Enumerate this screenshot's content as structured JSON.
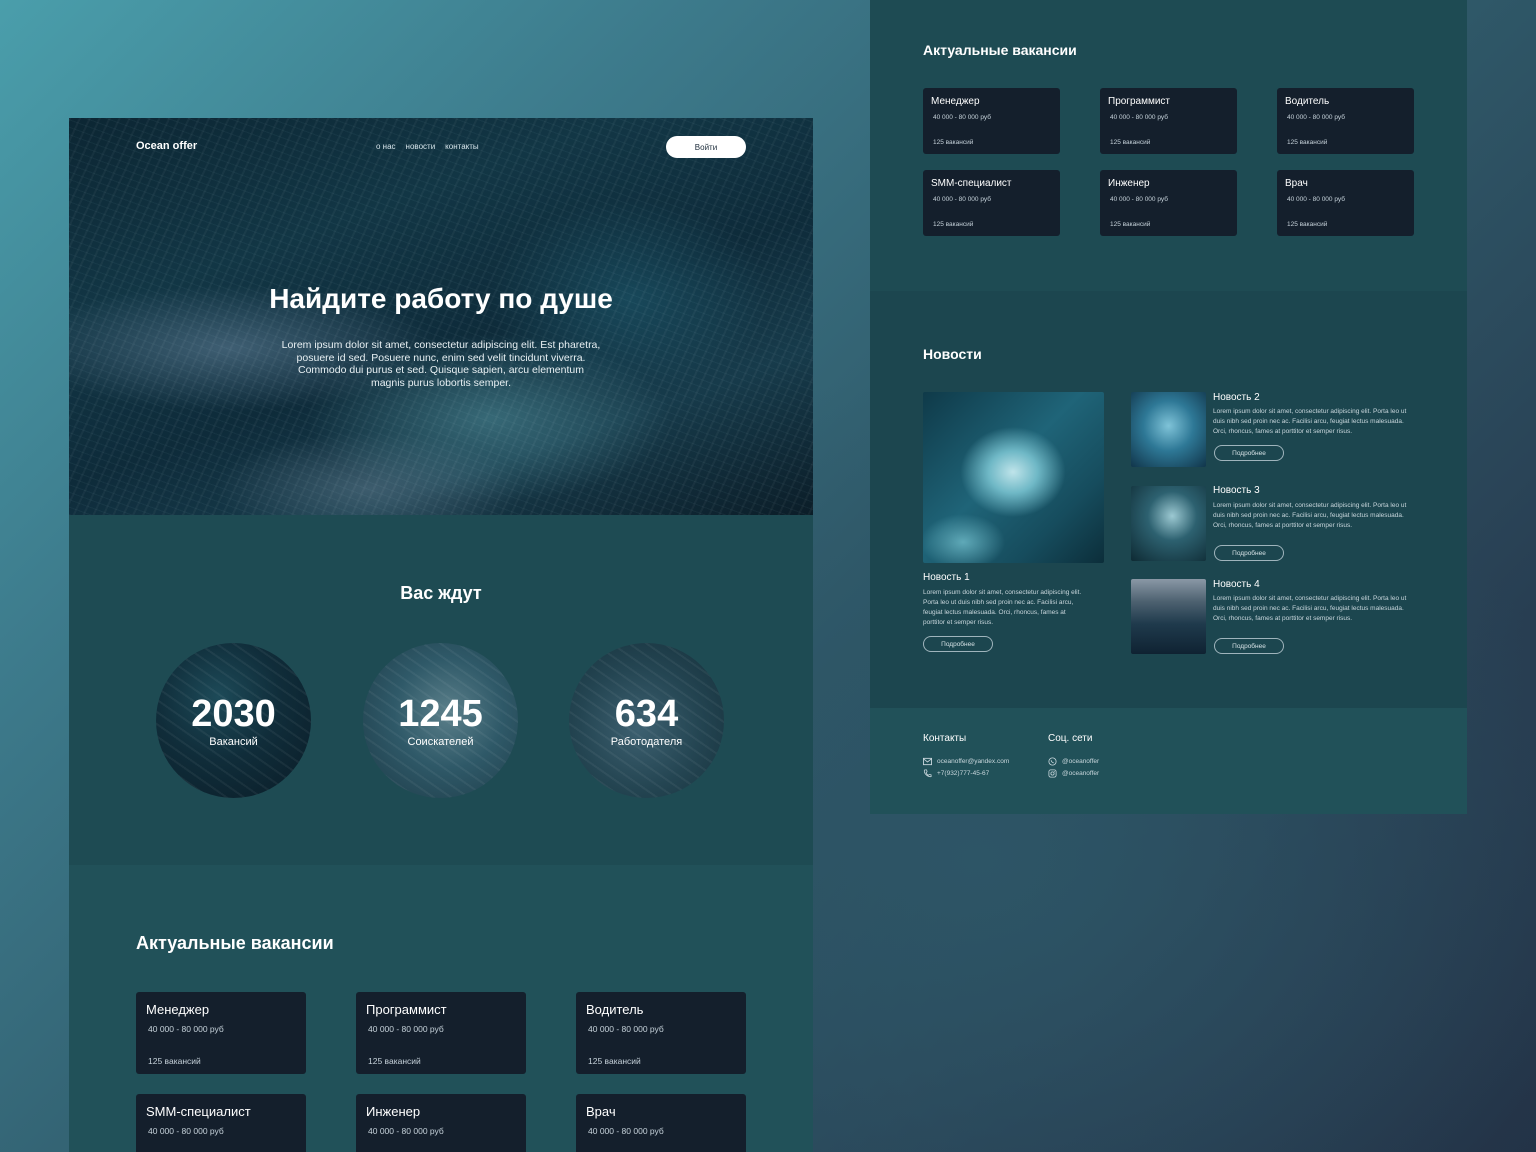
{
  "hero": {
    "logo": "Ocean offer",
    "nav": [
      "о нас",
      "новости",
      "контакты"
    ],
    "login_label": "Войти",
    "title": "Найдите работу по душе",
    "text": "Lorem ipsum dolor sit amet, consectetur adipiscing elit. Est pharetra, posuere id sed. Posuere nunc, enim sed velit tincidunt viverra. Commodo dui purus et sed. Quisque sapien, arcu elementum magnis purus lobortis semper."
  },
  "stats": {
    "title": "Вас ждут",
    "items": [
      {
        "value": "2030",
        "label": "Вакансий"
      },
      {
        "value": "1245",
        "label": "Соискателей"
      },
      {
        "value": "634",
        "label": "Работодателя"
      }
    ]
  },
  "vacancies": {
    "title": "Актуальные вакансии",
    "items": [
      {
        "title": "Менеджер",
        "salary": "40 000 - 80 000 руб",
        "count": "125 вакансий"
      },
      {
        "title": "Программист",
        "salary": "40 000 - 80 000 руб",
        "count": "125 вакансий"
      },
      {
        "title": "Водитель",
        "salary": "40 000 - 80 000 руб",
        "count": "125 вакансий"
      },
      {
        "title": "SMM-специалист",
        "salary": "40 000 - 80 000 руб",
        "count": "125 вакансий"
      },
      {
        "title": "Инженер",
        "salary": "40 000 - 80 000 руб",
        "count": "125 вакансий"
      },
      {
        "title": "Врач",
        "salary": "40 000 - 80 000 руб",
        "count": "125 вакансий"
      }
    ]
  },
  "news": {
    "title": "Новости",
    "more_label": "Подробнее",
    "items": [
      {
        "title": "Новость 1",
        "text": "Lorem ipsum dolor sit amet, consectetur adipiscing elit. Porta leo ut duis nibh sed proin nec ac. Facilisi arcu, feugiat lectus malesuada. Orci, rhoncus, fames at porttitor et semper risus."
      },
      {
        "title": "Новость 2",
        "text": "Lorem ipsum dolor sit amet, consectetur adipiscing elit. Porta leo ut duis nibh sed proin nec ac. Facilisi arcu, feugiat lectus malesuada. Orci, rhoncus, fames at porttitor et semper risus."
      },
      {
        "title": "Новость 3",
        "text": "Lorem ipsum dolor sit amet, consectetur adipiscing elit. Porta leo ut duis nibh sed proin nec ac. Facilisi arcu, feugiat lectus malesuada. Orci, rhoncus, fames at porttitor et semper risus."
      },
      {
        "title": "Новость 4",
        "text": "Lorem ipsum dolor sit amet, consectetur adipiscing elit. Porta leo ut duis nibh sed proin nec ac. Facilisi arcu, feugiat lectus malesuada. Orci, rhoncus, fames at porttitor et semper risus."
      }
    ]
  },
  "footer": {
    "contacts_title": "Контакты",
    "email": "oceanoffer@yandex.com",
    "phone": "+7(932)777-45-67",
    "social_title": "Соц. сети",
    "whatsapp": "@oceanoffer",
    "instagram": "@oceanoffer",
    "icons": [
      "mail-icon",
      "phone-icon",
      "whatsapp-icon",
      "instagram-icon"
    ]
  },
  "colors": {
    "section_bg": "#1e4b53",
    "card_bg": "#141f2c",
    "button_bg": "#ffffff"
  }
}
